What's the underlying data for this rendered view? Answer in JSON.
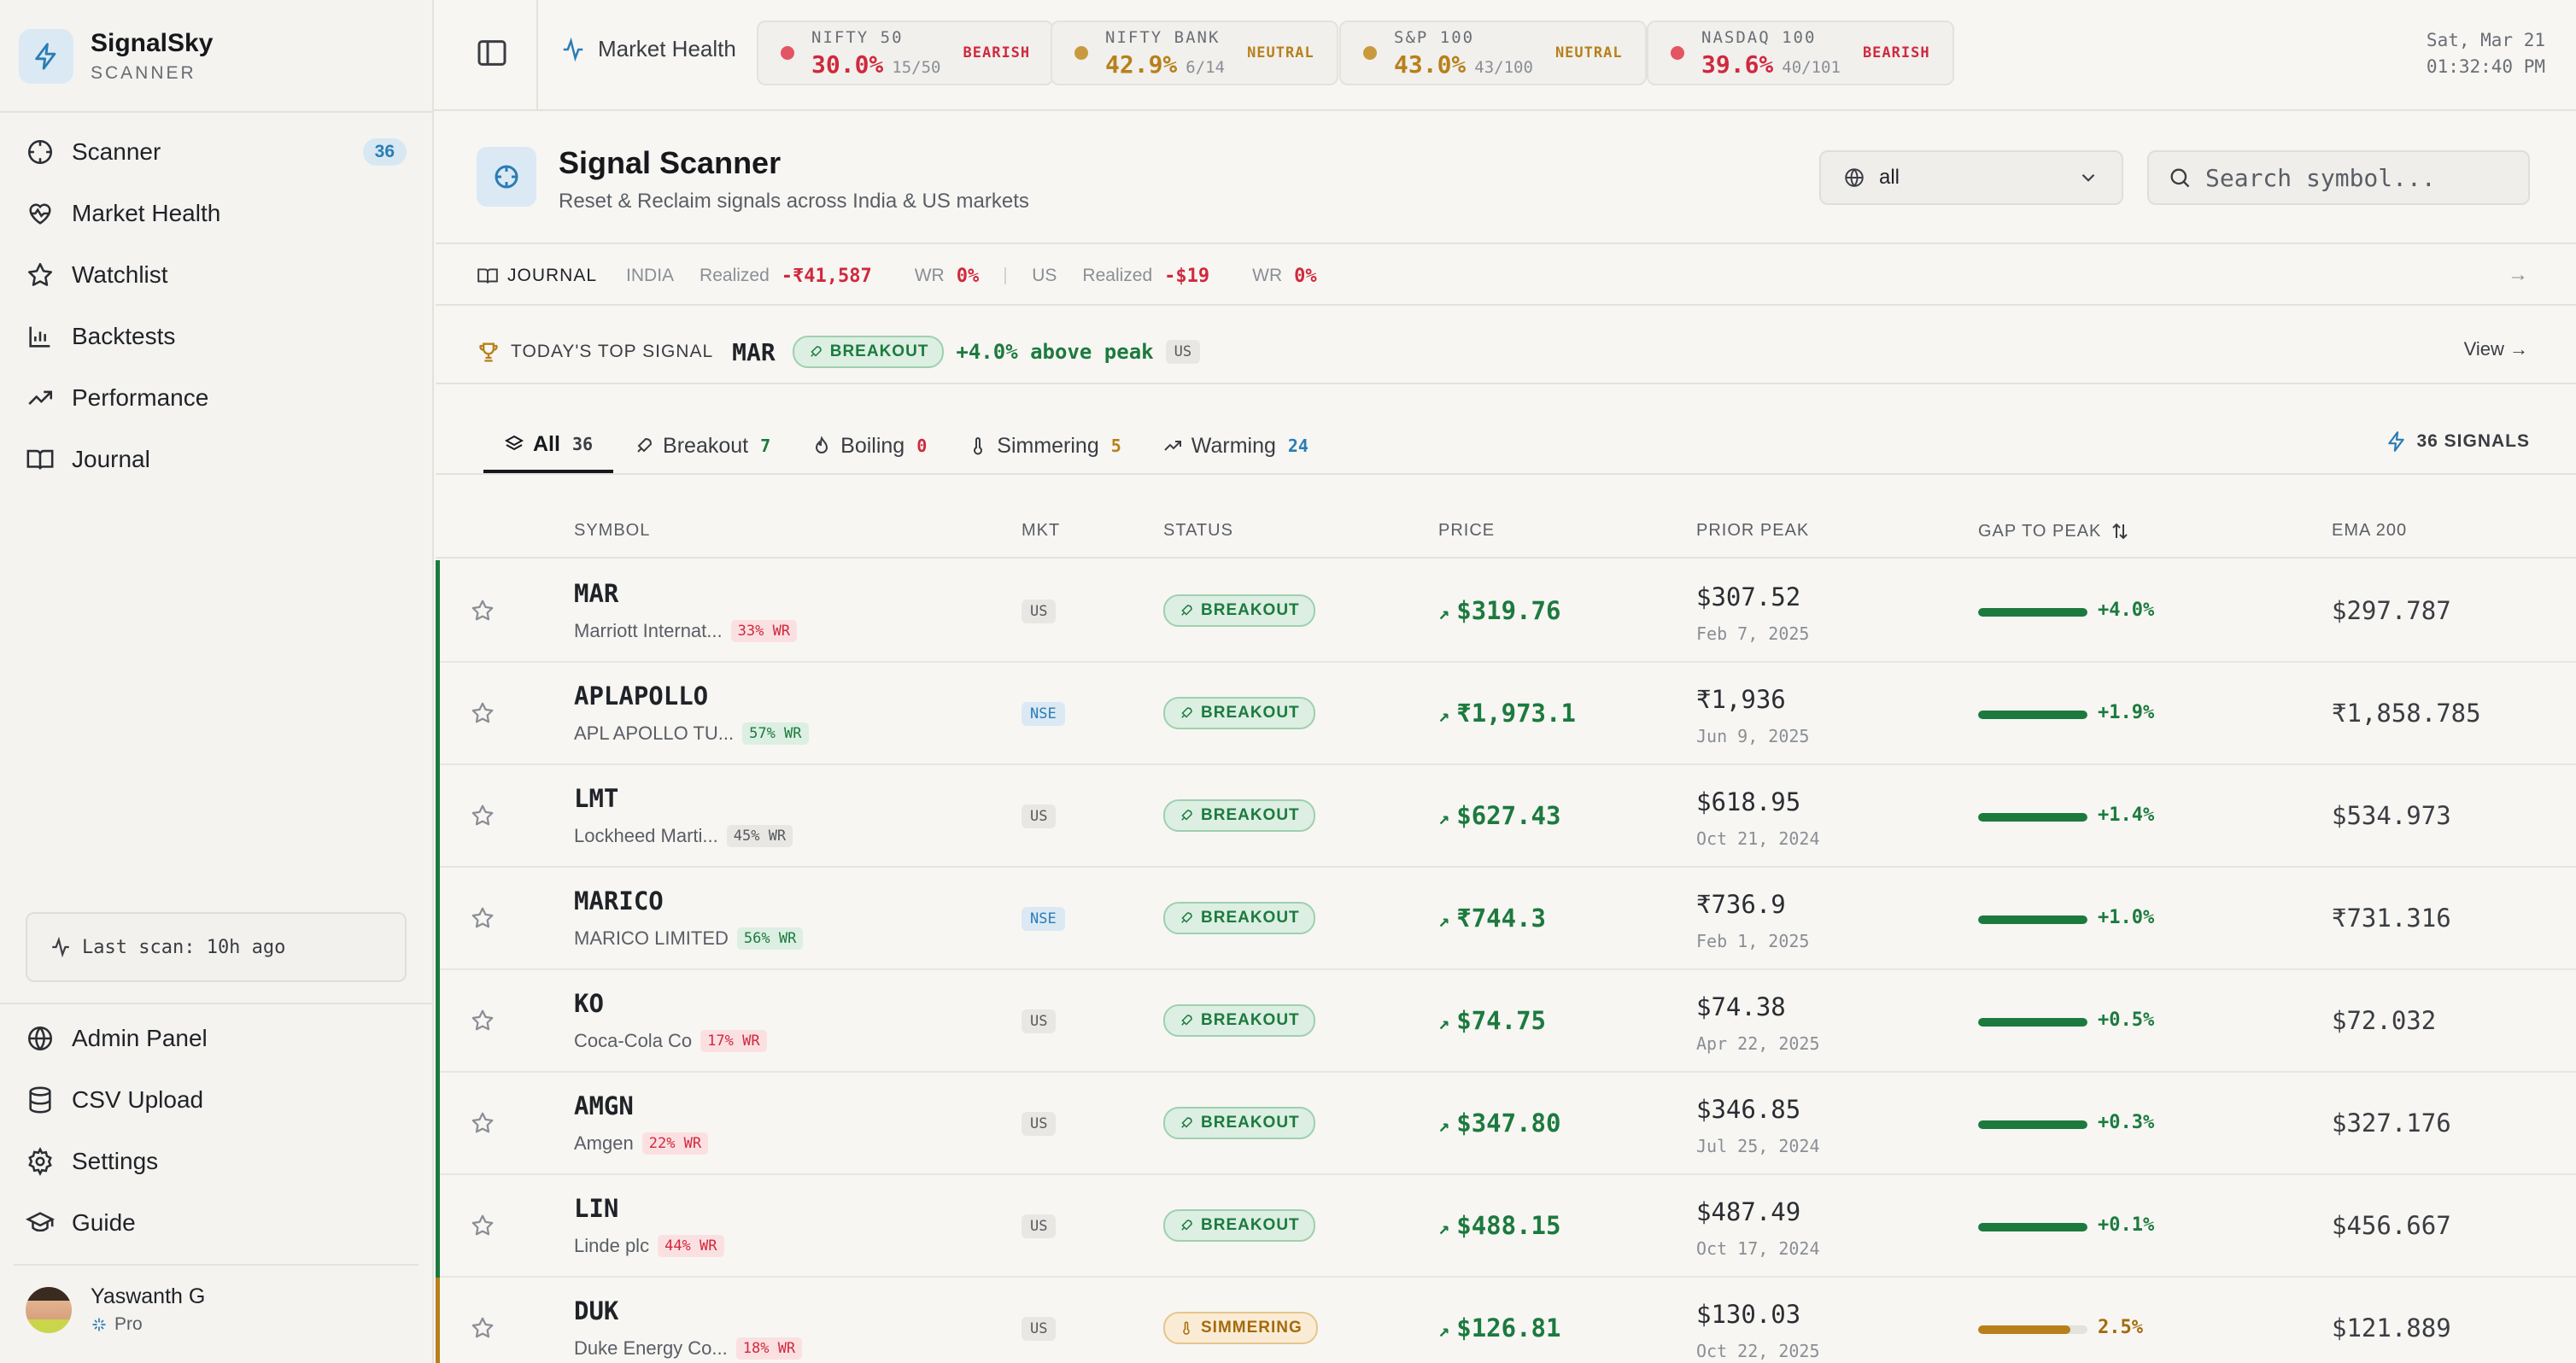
{
  "brand": {
    "name": "SignalSky",
    "sub": "SCANNER"
  },
  "sidebar": {
    "nav": [
      {
        "label": "Scanner",
        "badge": "36"
      },
      {
        "label": "Market Health"
      },
      {
        "label": "Watchlist"
      },
      {
        "label": "Backtests"
      },
      {
        "label": "Performance"
      },
      {
        "label": "Journal"
      }
    ],
    "last_scan": "Last scan: 10h ago",
    "bottom": [
      {
        "label": "Admin Panel"
      },
      {
        "label": "CSV Upload"
      },
      {
        "label": "Settings"
      },
      {
        "label": "Guide"
      }
    ],
    "user": {
      "name": "Yaswanth G",
      "plan": "Pro"
    }
  },
  "topbar": {
    "market_health": "Market Health",
    "indices": [
      {
        "name": "NIFTY 50",
        "pct": "30.0%",
        "count": "15/50",
        "sentiment": "BEARISH",
        "color": "#d0293d",
        "dot": "#e45563"
      },
      {
        "name": "NIFTY BANK",
        "pct": "42.9%",
        "count": "6/14",
        "sentiment": "NEUTRAL",
        "color": "#b7801a",
        "dot": "#c99a3d"
      },
      {
        "name": "S&P 100",
        "pct": "43.0%",
        "count": "43/100",
        "sentiment": "NEUTRAL",
        "color": "#b7801a",
        "dot": "#c99a3d"
      },
      {
        "name": "NASDAQ 100",
        "pct": "39.6%",
        "count": "40/101",
        "sentiment": "BEARISH",
        "color": "#d0293d",
        "dot": "#e45563"
      }
    ],
    "date": "Sat, Mar 21",
    "time": "01:32:40 PM"
  },
  "header": {
    "title": "Signal Scanner",
    "subtitle": "Reset & Reclaim signals across India & US markets",
    "market_select": "all",
    "search_placeholder": "Search symbol..."
  },
  "journal": {
    "label": "JOURNAL",
    "india": {
      "market": "INDIA",
      "realized_label": "Realized",
      "realized": "-₹41,587",
      "wr_label": "WR",
      "wr": "0%"
    },
    "us": {
      "market": "US",
      "realized_label": "Realized",
      "realized": "-$19",
      "wr_label": "WR",
      "wr": "0%"
    }
  },
  "top_signal": {
    "label": "TODAY'S TOP SIGNAL",
    "symbol": "MAR",
    "status": "BREAKOUT",
    "detail": "+4.0% above peak",
    "market": "US",
    "view": "View"
  },
  "tabs": [
    {
      "label": "All",
      "count": "36",
      "color": "#3a3d42"
    },
    {
      "label": "Breakout",
      "count": "7",
      "color": "#1c7a3e"
    },
    {
      "label": "Boiling",
      "count": "0",
      "color": "#d0293d"
    },
    {
      "label": "Simmering",
      "count": "5",
      "color": "#b7801a"
    },
    {
      "label": "Warming",
      "count": "24",
      "color": "#2a7db5"
    }
  ],
  "signal_count": "36 SIGNALS",
  "table": {
    "headers": {
      "symbol": "SYMBOL",
      "mkt": "MKT",
      "status": "STATUS",
      "price": "PRICE",
      "prior_peak": "PRIOR PEAK",
      "gap": "GAP TO PEAK",
      "ema": "EMA 200"
    },
    "rows": [
      {
        "symbol": "MAR",
        "company": "Marriott Internat...",
        "wr": "33% WR",
        "wr_level": "lo",
        "mkt": "US",
        "status": "BREAKOUT",
        "price": "$319.76",
        "peak": "$307.52",
        "peak_date": "Feb 7, 2025",
        "gap": "+4.0%",
        "gap_fill": 1.0,
        "ema": "$297.787"
      },
      {
        "symbol": "APLAPOLLO",
        "company": "APL APOLLO TU...",
        "wr": "57% WR",
        "wr_level": "hi",
        "mkt": "NSE",
        "status": "BREAKOUT",
        "price": "₹1,973.1",
        "peak": "₹1,936",
        "peak_date": "Jun 9, 2025",
        "gap": "+1.9%",
        "gap_fill": 1.0,
        "ema": "₹1,858.785"
      },
      {
        "symbol": "LMT",
        "company": "Lockheed Marti...",
        "wr": "45% WR",
        "wr_level": "mid",
        "mkt": "US",
        "status": "BREAKOUT",
        "price": "$627.43",
        "peak": "$618.95",
        "peak_date": "Oct 21, 2024",
        "gap": "+1.4%",
        "gap_fill": 1.0,
        "ema": "$534.973"
      },
      {
        "symbol": "MARICO",
        "company": "MARICO LIMITED",
        "wr": "56% WR",
        "wr_level": "hi",
        "mkt": "NSE",
        "status": "BREAKOUT",
        "price": "₹744.3",
        "peak": "₹736.9",
        "peak_date": "Feb 1, 2025",
        "gap": "+1.0%",
        "gap_fill": 1.0,
        "ema": "₹731.316"
      },
      {
        "symbol": "KO",
        "company": "Coca-Cola Co",
        "wr": "17% WR",
        "wr_level": "lo",
        "mkt": "US",
        "status": "BREAKOUT",
        "price": "$74.75",
        "peak": "$74.38",
        "peak_date": "Apr 22, 2025",
        "gap": "+0.5%",
        "gap_fill": 1.0,
        "ema": "$72.032"
      },
      {
        "symbol": "AMGN",
        "company": "Amgen",
        "wr": "22% WR",
        "wr_level": "lo",
        "mkt": "US",
        "status": "BREAKOUT",
        "price": "$347.80",
        "peak": "$346.85",
        "peak_date": "Jul 25, 2024",
        "gap": "+0.3%",
        "gap_fill": 1.0,
        "ema": "$327.176"
      },
      {
        "symbol": "LIN",
        "company": "Linde plc",
        "wr": "44% WR",
        "wr_level": "lo",
        "mkt": "US",
        "status": "BREAKOUT",
        "price": "$488.15",
        "peak": "$487.49",
        "peak_date": "Oct 17, 2024",
        "gap": "+0.1%",
        "gap_fill": 1.0,
        "ema": "$456.667"
      },
      {
        "symbol": "DUK",
        "company": "Duke Energy Co...",
        "wr": "18% WR",
        "wr_level": "lo",
        "mkt": "US",
        "status": "SIMMERING",
        "price": "$126.81",
        "peak": "$130.03",
        "peak_date": "Oct 22, 2025",
        "gap": "2.5%",
        "gap_fill": 0.84,
        "ema": "$121.889"
      }
    ]
  },
  "colors": {
    "breakout": "#1c7a3e",
    "simmering": "#a56a0b",
    "accent": "#2a7db5",
    "negative": "#d0293d"
  }
}
